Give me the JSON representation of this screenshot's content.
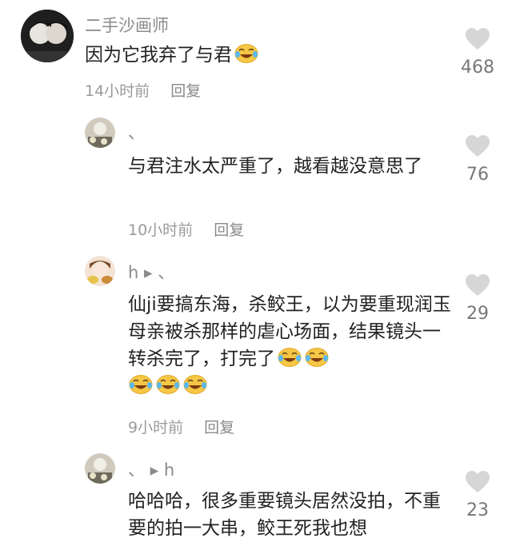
{
  "comments": [
    {
      "username": "二手沙画师",
      "text": "因为它我弃了与君",
      "emoji_count": 1,
      "time": "14小时前",
      "reply_label": "回复",
      "likes": "468"
    },
    {
      "username": "、",
      "text": "与君注水太严重了，越看越没意思了",
      "emoji_count": 0,
      "time": "10小时前",
      "reply_label": "回复",
      "likes": "76"
    },
    {
      "username": "h ▸ 、",
      "text": "仙ji要搞东海，杀鲛王，以为要重现润玉母亲被杀那样的虐心场面，结果镜头一转杀完了，打完了",
      "emoji_count": 5,
      "time": "9小时前",
      "reply_label": "回复",
      "likes": "29"
    },
    {
      "username": "、 ▸ h",
      "text": "哈哈哈，很多重要镜头居然没拍，不重要的拍一大串，鲛王死我也想",
      "emoji_count": 0,
      "likes": "23"
    }
  ],
  "colors": {
    "username": "#8a8a8a",
    "meta": "#9a9a9a",
    "heart": "#d6d6d6",
    "emoji": "#f7c948"
  }
}
